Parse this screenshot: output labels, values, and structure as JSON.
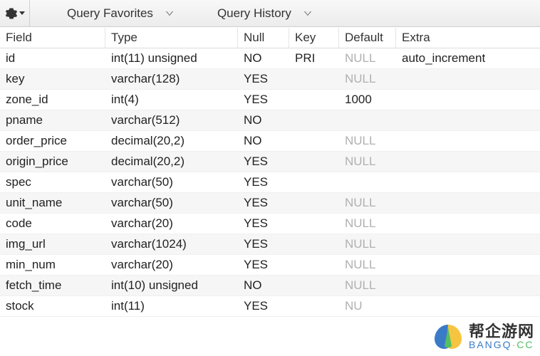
{
  "toolbar": {
    "favorites_label": "Query Favorites",
    "history_label": "Query History"
  },
  "columns": {
    "field": "Field",
    "type": "Type",
    "null": "Null",
    "key": "Key",
    "default": "Default",
    "extra": "Extra"
  },
  "rows": [
    {
      "field": "id",
      "type": "int(11) unsigned",
      "null": "NO",
      "key": "PRI",
      "default": "NULL",
      "default_is_null": true,
      "extra": "auto_increment"
    },
    {
      "field": "key",
      "type": "varchar(128)",
      "null": "YES",
      "key": "",
      "default": "NULL",
      "default_is_null": true,
      "extra": ""
    },
    {
      "field": "zone_id",
      "type": "int(4)",
      "null": "YES",
      "key": "",
      "default": "1000",
      "default_is_null": false,
      "extra": ""
    },
    {
      "field": "pname",
      "type": "varchar(512)",
      "null": "NO",
      "key": "",
      "default": "",
      "default_is_null": false,
      "extra": ""
    },
    {
      "field": "order_price",
      "type": "decimal(20,2)",
      "null": "NO",
      "key": "",
      "default": "NULL",
      "default_is_null": true,
      "extra": ""
    },
    {
      "field": "origin_price",
      "type": "decimal(20,2)",
      "null": "YES",
      "key": "",
      "default": "NULL",
      "default_is_null": true,
      "extra": ""
    },
    {
      "field": "spec",
      "type": "varchar(50)",
      "null": "YES",
      "key": "",
      "default": "",
      "default_is_null": false,
      "extra": ""
    },
    {
      "field": "unit_name",
      "type": "varchar(50)",
      "null": "YES",
      "key": "",
      "default": "NULL",
      "default_is_null": true,
      "extra": ""
    },
    {
      "field": "code",
      "type": "varchar(20)",
      "null": "YES",
      "key": "",
      "default": "NULL",
      "default_is_null": true,
      "extra": ""
    },
    {
      "field": "img_url",
      "type": "varchar(1024)",
      "null": "YES",
      "key": "",
      "default": "NULL",
      "default_is_null": true,
      "extra": ""
    },
    {
      "field": "min_num",
      "type": "varchar(20)",
      "null": "YES",
      "key": "",
      "default": "NULL",
      "default_is_null": true,
      "extra": ""
    },
    {
      "field": "fetch_time",
      "type": "int(10) unsigned",
      "null": "NO",
      "key": "",
      "default": "NULL",
      "default_is_null": true,
      "extra": ""
    },
    {
      "field": "stock",
      "type": "int(11)",
      "null": "YES",
      "key": "",
      "default": "NU",
      "default_is_null": true,
      "extra": ""
    }
  ],
  "watermark": {
    "chinese": "帮企游网",
    "url_part1": "BANGQ",
    "url_dot": "·",
    "url_part2": "CC"
  }
}
